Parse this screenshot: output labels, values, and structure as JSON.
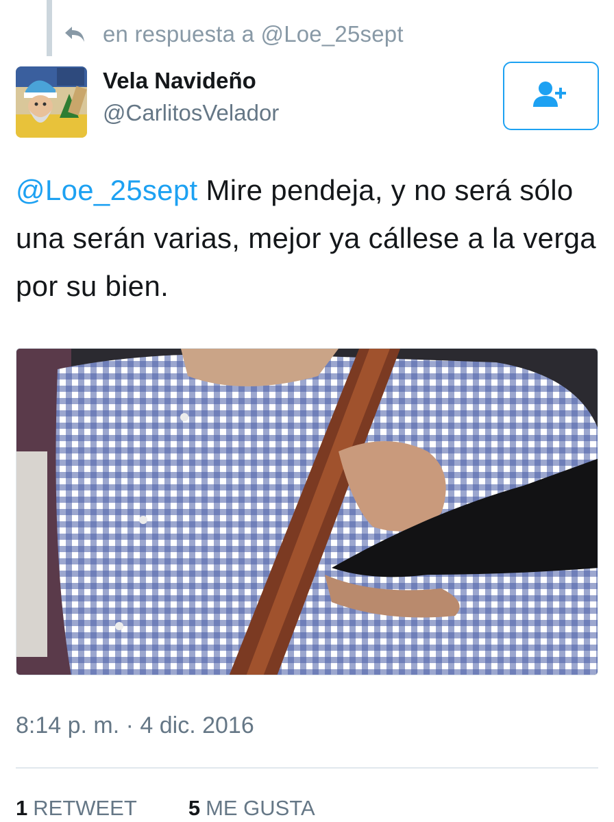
{
  "reply_context": {
    "prefix": "en respuesta a",
    "mention": "@Loe_25sept",
    "icon": "reply-icon"
  },
  "user": {
    "display_name": "Vela Navideño",
    "handle": "@CarlitosVelador",
    "avatar": "cartoon-avatar"
  },
  "follow_button": {
    "icon": "add-user-icon"
  },
  "tweet": {
    "mention": "@Loe_25sept",
    "body": " Mire pendeja, y no será sólo una serán varias, mejor ya cállese a la verga por su bien."
  },
  "media": {
    "type": "photo"
  },
  "timestamp": "8:14 p. m. · 4 dic. 2016",
  "stats": {
    "retweets": {
      "count": "1",
      "label": "RETWEET"
    },
    "likes": {
      "count": "5",
      "label": "ME GUSTA"
    }
  },
  "colors": {
    "accent": "#1da1f2",
    "secondary_text": "#657786",
    "muted_text": "#8899a6",
    "divider": "#e1e8ed"
  }
}
